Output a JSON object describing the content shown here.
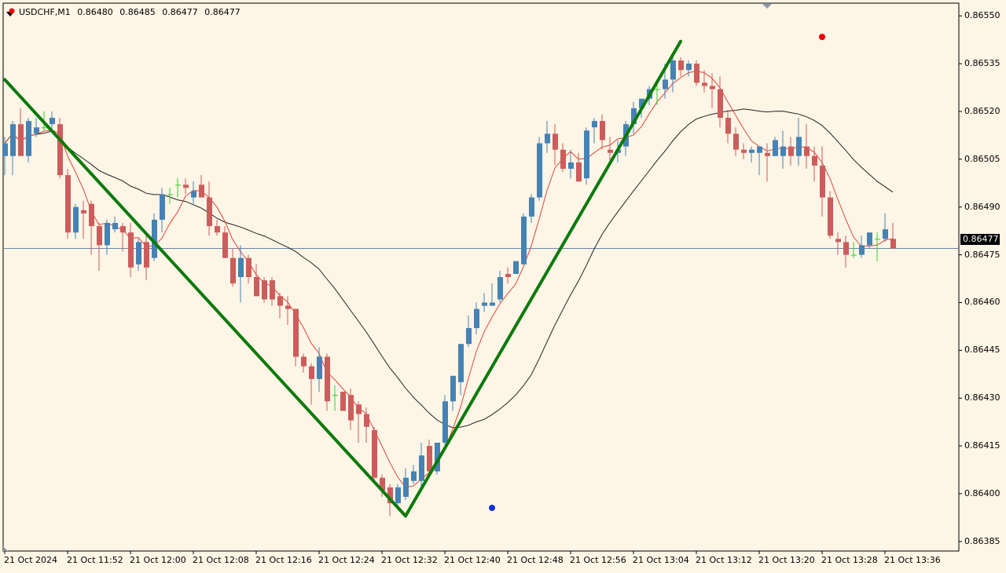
{
  "symbol": {
    "name": "USDCHF,M1",
    "open": "0.86480",
    "high": "0.86485",
    "low": "0.86477",
    "close": "0.86477"
  },
  "price_axis": {
    "labels": [
      "0.86550",
      "0.86535",
      "0.86520",
      "0.86505",
      "0.86490",
      "0.86475",
      "0.86460",
      "0.86445",
      "0.86430",
      "0.86415",
      "0.86400",
      "0.86385"
    ],
    "current": "0.86477"
  },
  "time_axis": {
    "labels": [
      "21 Oct 2024",
      "21 Oct 11:52",
      "21 Oct 12:00",
      "21 Oct 12:08",
      "21 Oct 12:16",
      "21 Oct 12:24",
      "21 Oct 12:32",
      "21 Oct 12:40",
      "21 Oct 12:48",
      "21 Oct 12:56",
      "21 Oct 13:04",
      "21 Oct 13:12",
      "21 Oct 13:20",
      "21 Oct 13:28",
      "21 Oct 13:36"
    ]
  },
  "colors": {
    "bull": "#4682b4",
    "bear": "#cd5c5c",
    "doji": "#32cd32",
    "fast_ma": "#e0463c",
    "slow_ma": "#222222",
    "zigzag": "#0a7a0a",
    "price_line": "#6a86a8",
    "background": "#fdf5e6"
  },
  "chart_data": {
    "type": "candlestick",
    "ylim": [
      0.86382,
      0.86554
    ],
    "candles": [
      [
        0.86506,
        0.86512,
        0.865,
        0.8651
      ],
      [
        0.86506,
        0.86517,
        0.865,
        0.86516
      ],
      [
        0.86516,
        0.86521,
        0.86508,
        0.86506
      ],
      [
        0.86506,
        0.86518,
        0.86504,
        0.86517
      ],
      [
        0.86513,
        0.86518,
        0.86512,
        0.86515
      ],
      [
        0.86515,
        0.8652,
        0.86514,
        0.86515
      ],
      [
        0.86516,
        0.8652,
        0.86514,
        0.86518
      ],
      [
        0.86516,
        0.86518,
        0.86499,
        0.865
      ],
      [
        0.865,
        0.86502,
        0.8648,
        0.86482
      ],
      [
        0.86482,
        0.86491,
        0.8648,
        0.8649
      ],
      [
        0.86489,
        0.86492,
        0.8648,
        0.86488
      ],
      [
        0.86491,
        0.86492,
        0.86475,
        0.86484
      ],
      [
        0.86484,
        0.86485,
        0.8647,
        0.86478
      ],
      [
        0.86478,
        0.86486,
        0.86475,
        0.86485
      ],
      [
        0.86483,
        0.86487,
        0.86482,
        0.86485
      ],
      [
        0.86484,
        0.86485,
        0.86476,
        0.86482
      ],
      [
        0.86482,
        0.86485,
        0.86468,
        0.86471
      ],
      [
        0.86472,
        0.8648,
        0.8647,
        0.86479
      ],
      [
        0.86479,
        0.86481,
        0.86467,
        0.86471
      ],
      [
        0.86474,
        0.86488,
        0.86473,
        0.86486
      ],
      [
        0.86486,
        0.86496,
        0.86482,
        0.86494
      ],
      [
        0.86494,
        0.86496,
        0.86491,
        0.86494
      ],
      [
        0.86497,
        0.86499,
        0.86493,
        0.86497
      ],
      [
        0.86497,
        0.86499,
        0.86494,
        0.86496
      ],
      [
        0.86493,
        0.86498,
        0.86491,
        0.86495
      ],
      [
        0.86497,
        0.865,
        0.86493,
        0.86493
      ],
      [
        0.86493,
        0.86498,
        0.86481,
        0.86484
      ],
      [
        0.86484,
        0.86486,
        0.86481,
        0.86482
      ],
      [
        0.86482,
        0.86484,
        0.86474,
        0.86474
      ],
      [
        0.86474,
        0.86477,
        0.86465,
        0.86466
      ],
      [
        0.86468,
        0.86478,
        0.8646,
        0.86474
      ],
      [
        0.86474,
        0.86475,
        0.86466,
        0.86468
      ],
      [
        0.86468,
        0.86472,
        0.86466,
        0.86462
      ],
      [
        0.86467,
        0.86468,
        0.8646,
        0.86461
      ],
      [
        0.86467,
        0.86468,
        0.86459,
        0.86461
      ],
      [
        0.86462,
        0.86463,
        0.86455,
        0.86459
      ],
      [
        0.86459,
        0.86462,
        0.86453,
        0.86458
      ],
      [
        0.86458,
        0.86457,
        0.8644,
        0.86443
      ],
      [
        0.86443,
        0.86444,
        0.86438,
        0.8644
      ],
      [
        0.8644,
        0.86441,
        0.86428,
        0.86436
      ],
      [
        0.86436,
        0.86446,
        0.86432,
        0.86443
      ],
      [
        0.86443,
        0.86444,
        0.86426,
        0.86429
      ],
      [
        0.86431,
        0.86434,
        0.86426,
        0.86431
      ],
      [
        0.86432,
        0.86432,
        0.86428,
        0.86426
      ],
      [
        0.86431,
        0.86433,
        0.8642,
        0.86423
      ],
      [
        0.86428,
        0.86429,
        0.86416,
        0.86425
      ],
      [
        0.86425,
        0.86427,
        0.86416,
        0.86421
      ],
      [
        0.8642,
        0.86421,
        0.86404,
        0.86405
      ],
      [
        0.86405,
        0.86406,
        0.86399,
        0.86401
      ],
      [
        0.86402,
        0.86403,
        0.86393,
        0.86397
      ],
      [
        0.86397,
        0.86403,
        0.86395,
        0.86402
      ],
      [
        0.86399,
        0.86408,
        0.86398,
        0.86405
      ],
      [
        0.86404,
        0.86409,
        0.86403,
        0.86407
      ],
      [
        0.86404,
        0.86416,
        0.86402,
        0.86412
      ],
      [
        0.86415,
        0.86417,
        0.86406,
        0.86407
      ],
      [
        0.86407,
        0.86415,
        0.86406,
        0.86416
      ],
      [
        0.86416,
        0.86431,
        0.86414,
        0.86429
      ],
      [
        0.86429,
        0.86434,
        0.86426,
        0.86437
      ],
      [
        0.86435,
        0.86447,
        0.86431,
        0.86447
      ],
      [
        0.86447,
        0.86456,
        0.86446,
        0.86452
      ],
      [
        0.86452,
        0.8646,
        0.8645,
        0.86458
      ],
      [
        0.86459,
        0.86463,
        0.86457,
        0.8646
      ],
      [
        0.86459,
        0.86466,
        0.8646,
        0.8646
      ],
      [
        0.86461,
        0.8647,
        0.8646,
        0.86468
      ],
      [
        0.86469,
        0.86471,
        0.86466,
        0.86468
      ],
      [
        0.86469,
        0.86471,
        0.8647,
        0.86473
      ],
      [
        0.86472,
        0.86488,
        0.86472,
        0.86487
      ],
      [
        0.86487,
        0.86494,
        0.86485,
        0.86493
      ],
      [
        0.86493,
        0.86512,
        0.86492,
        0.8651
      ],
      [
        0.8651,
        0.86517,
        0.86507,
        0.86513
      ],
      [
        0.86513,
        0.86516,
        0.86503,
        0.86508
      ],
      [
        0.86508,
        0.8651,
        0.86501,
        0.86502
      ],
      [
        0.86502,
        0.86508,
        0.86499,
        0.86504
      ],
      [
        0.86504,
        0.86507,
        0.86498,
        0.86498
      ],
      [
        0.86499,
        0.86515,
        0.86497,
        0.86514
      ],
      [
        0.86515,
        0.86518,
        0.8651,
        0.86517
      ],
      [
        0.86517,
        0.86519,
        0.86508,
        0.86511
      ],
      [
        0.86508,
        0.86512,
        0.86504,
        0.86507
      ],
      [
        0.86507,
        0.86511,
        0.86504,
        0.86508
      ],
      [
        0.86509,
        0.86517,
        0.86506,
        0.86516
      ],
      [
        0.86516,
        0.86523,
        0.86513,
        0.86521
      ],
      [
        0.86521,
        0.86524,
        0.86518,
        0.86524
      ],
      [
        0.86524,
        0.86528,
        0.86522,
        0.86527
      ],
      [
        0.86527,
        0.86529,
        0.86522,
        0.86527
      ],
      [
        0.86527,
        0.86535,
        0.86524,
        0.8653
      ],
      [
        0.8653,
        0.86537,
        0.86526,
        0.86536
      ],
      [
        0.86536,
        0.86537,
        0.86531,
        0.86533
      ],
      [
        0.86533,
        0.86536,
        0.86531,
        0.86535
      ],
      [
        0.86535,
        0.86536,
        0.86528,
        0.86529
      ],
      [
        0.86529,
        0.86533,
        0.86526,
        0.86528
      ],
      [
        0.86528,
        0.86532,
        0.86521,
        0.86527
      ],
      [
        0.86527,
        0.86531,
        0.86515,
        0.86518
      ],
      [
        0.86518,
        0.8652,
        0.8651,
        0.86513
      ],
      [
        0.86513,
        0.86515,
        0.86506,
        0.86508
      ],
      [
        0.86508,
        0.8651,
        0.86505,
        0.86507
      ],
      [
        0.86507,
        0.86509,
        0.86504,
        0.86508
      ],
      [
        0.86507,
        0.86509,
        0.865,
        0.86509
      ],
      [
        0.86507,
        0.8651,
        0.86498,
        0.86506
      ],
      [
        0.86506,
        0.86512,
        0.86506,
        0.86511
      ],
      [
        0.86506,
        0.86514,
        0.86502,
        0.86509
      ],
      [
        0.86509,
        0.86512,
        0.86503,
        0.86506
      ],
      [
        0.86506,
        0.86518,
        0.86503,
        0.86512
      ],
      [
        0.86509,
        0.86516,
        0.86502,
        0.86506
      ],
      [
        0.86506,
        0.86509,
        0.86498,
        0.86503
      ],
      [
        0.86503,
        0.86509,
        0.86487,
        0.86493
      ],
      [
        0.86493,
        0.86495,
        0.8648,
        0.86481
      ],
      [
        0.8648,
        0.86482,
        0.86475,
        0.86479
      ],
      [
        0.86479,
        0.86481,
        0.86471,
        0.86475
      ],
      [
        0.86475,
        0.86479,
        0.86474,
        0.86475
      ],
      [
        0.86475,
        0.86481,
        0.86474,
        0.86478
      ],
      [
        0.86478,
        0.86482,
        0.86477,
        0.86482
      ],
      [
        0.8648,
        0.86482,
        0.86473,
        0.8648
      ],
      [
        0.8648,
        0.86488,
        0.86479,
        0.86483
      ],
      [
        0.8648,
        0.86485,
        0.86477,
        0.86477
      ]
    ]
  }
}
